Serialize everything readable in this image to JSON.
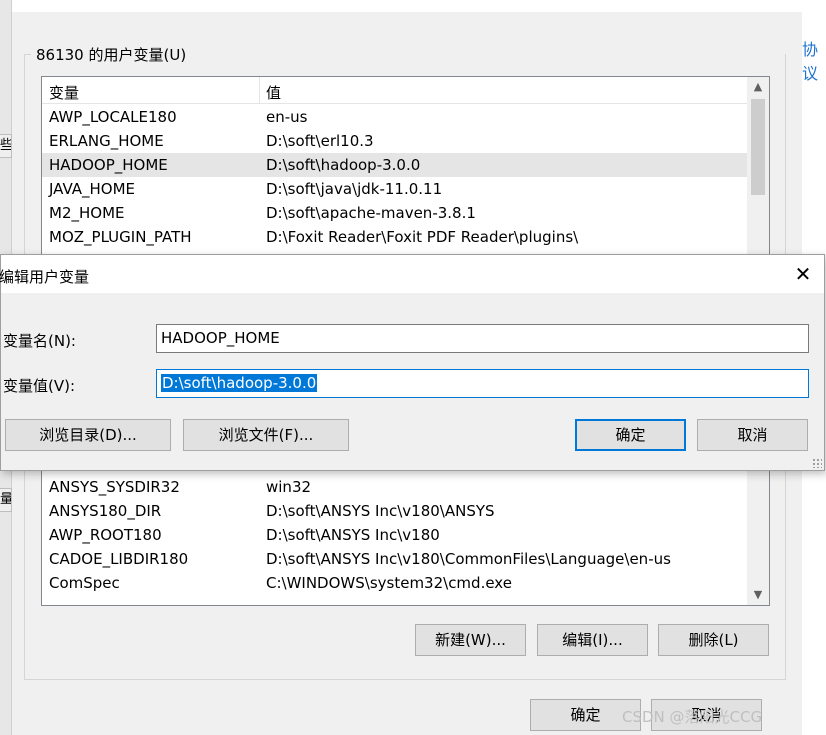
{
  "background_window": {
    "left_strip_glyphs": [
      "些",
      "量"
    ],
    "right_link": "协议",
    "group_label": "86130 的用户变量(U)",
    "columns": {
      "variable": "变量",
      "value": "值"
    },
    "rows_top": [
      {
        "name": "AWP_LOCALE180",
        "value": "en-us"
      },
      {
        "name": "ERLANG_HOME",
        "value": "D:\\soft\\erl10.3"
      },
      {
        "name": "HADOOP_HOME",
        "value": "D:\\soft\\hadoop-3.0.0"
      },
      {
        "name": "JAVA_HOME",
        "value": "D:\\soft\\java\\jdk-11.0.11"
      },
      {
        "name": "M2_HOME",
        "value": "D:\\soft\\apache-maven-3.8.1"
      },
      {
        "name": "MOZ_PLUGIN_PATH",
        "value": "D:\\Foxit Reader\\Foxit PDF Reader\\plugins\\"
      }
    ],
    "rows_bottom": [
      {
        "name": "ANSYS_SYSDIR32",
        "value": "win32"
      },
      {
        "name": "ANSYS180_DIR",
        "value": "D:\\soft\\ANSYS Inc\\v180\\ANSYS"
      },
      {
        "name": "AWP_ROOT180",
        "value": "D:\\soft\\ANSYS Inc\\v180"
      },
      {
        "name": "CADOE_LIBDIR180",
        "value": "D:\\soft\\ANSYS Inc\\v180\\CommonFiles\\Language\\en-us"
      },
      {
        "name": "ComSpec",
        "value": "C:\\WINDOWS\\system32\\cmd.exe"
      }
    ],
    "buttons": {
      "new": "新建(W)...",
      "edit": "编辑(I)...",
      "delete": "删除(L)",
      "ok": "确定",
      "cancel": "取消"
    }
  },
  "dialog": {
    "title": "编辑用户变量",
    "name_label": "变量名(N):",
    "name_value": "HADOOP_HOME",
    "value_label": "变量值(V):",
    "value_value": "D:\\soft\\hadoop-3.0.0",
    "browse_dir": "浏览目录(D)...",
    "browse_file": "浏览文件(F)...",
    "ok": "确定",
    "cancel": "取消"
  },
  "watermark": "CSDN @落阳光CCG",
  "colors": {
    "accent": "#0078d7",
    "window_bg": "#f0f0f0",
    "link": "#1e73d2"
  }
}
